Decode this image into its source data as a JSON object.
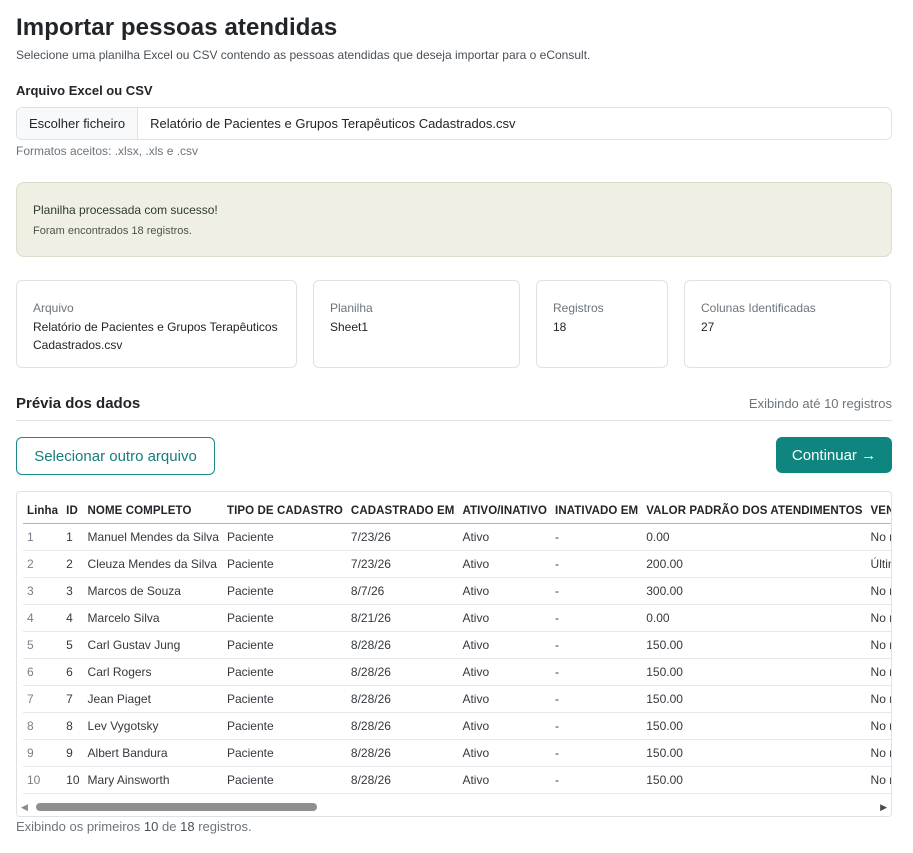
{
  "page": {
    "title": "Importar pessoas atendidas",
    "subtitle": "Selecione uma planilha Excel ou CSV contendo as pessoas atendidas que deseja importar para o eConsult."
  },
  "file_field": {
    "label": "Arquivo Excel ou CSV",
    "button_label": "Escolher ficheiro",
    "file_name": "Relatório de Pacientes e Grupos Terapêuticos Cadastrados.csv",
    "hint": "Formatos aceitos: .xlsx, .xls e .csv"
  },
  "alert": {
    "title": "Planilha processada com sucesso!",
    "message": "Foram encontrados 18 registros.",
    "color": "#f0efe4"
  },
  "summary": [
    {
      "label": "Arquivo",
      "value": "Relatório de Pacientes e Grupos Terapêuticos Cadastrados.csv"
    },
    {
      "label": "Planilha",
      "value": "Sheet1"
    },
    {
      "label": "Registros",
      "value": "18"
    },
    {
      "label": "Colunas Identificadas",
      "value": "27"
    }
  ],
  "preview": {
    "title": "Prévia dos dados",
    "meta": "Exibindo até 10 registros"
  },
  "actions": {
    "select_other": "Selecionar outro arquivo",
    "continue": "Continuar →",
    "accent_color": "#0f8580"
  },
  "table": {
    "columns": [
      "Linha",
      "ID",
      "NOME COMPLETO",
      "TIPO DE CADASTRO",
      "CADASTRADO EM",
      "ATIVO/INATIVO",
      "INATIVADO EM",
      "VALOR PADRÃO DOS ATENDIMENTOS",
      "VENCIMENTO"
    ],
    "rows": [
      [
        "1",
        "1",
        "Manuel Mendes da Silva",
        "Paciente",
        "7/23/26",
        "Ativo",
        "-",
        "0.00",
        "No mesmo dia"
      ],
      [
        "2",
        "2",
        "Cleuza Mendes da Silva",
        "Paciente",
        "7/23/26",
        "Ativo",
        "-",
        "200.00",
        "Último dia do"
      ],
      [
        "3",
        "3",
        "Marcos de Souza",
        "Paciente",
        "8/7/26",
        "Ativo",
        "-",
        "300.00",
        "No mesmo dia"
      ],
      [
        "4",
        "4",
        "Marcelo Silva",
        "Paciente",
        "8/21/26",
        "Ativo",
        "-",
        "0.00",
        "No mesmo dia"
      ],
      [
        "5",
        "5",
        "Carl Gustav Jung",
        "Paciente",
        "8/28/26",
        "Ativo",
        "-",
        "150.00",
        "No mesmo dia"
      ],
      [
        "6",
        "6",
        "Carl Rogers",
        "Paciente",
        "8/28/26",
        "Ativo",
        "-",
        "150.00",
        "No mesmo dia"
      ],
      [
        "7",
        "7",
        "Jean Piaget",
        "Paciente",
        "8/28/26",
        "Ativo",
        "-",
        "150.00",
        "No mesmo dia"
      ],
      [
        "8",
        "8",
        "Lev Vygotsky",
        "Paciente",
        "8/28/26",
        "Ativo",
        "-",
        "150.00",
        "No mesmo dia"
      ],
      [
        "9",
        "9",
        "Albert Bandura",
        "Paciente",
        "8/28/26",
        "Ativo",
        "-",
        "150.00",
        "No mesmo dia"
      ],
      [
        "10",
        "10",
        "Mary Ainsworth",
        "Paciente",
        "8/28/26",
        "Ativo",
        "-",
        "150.00",
        "No mesmo dia"
      ]
    ]
  },
  "footer": {
    "prefix": "Exibindo os primeiros",
    "shown": "10",
    "middle": "de",
    "total": "18",
    "suffix": "registros."
  }
}
